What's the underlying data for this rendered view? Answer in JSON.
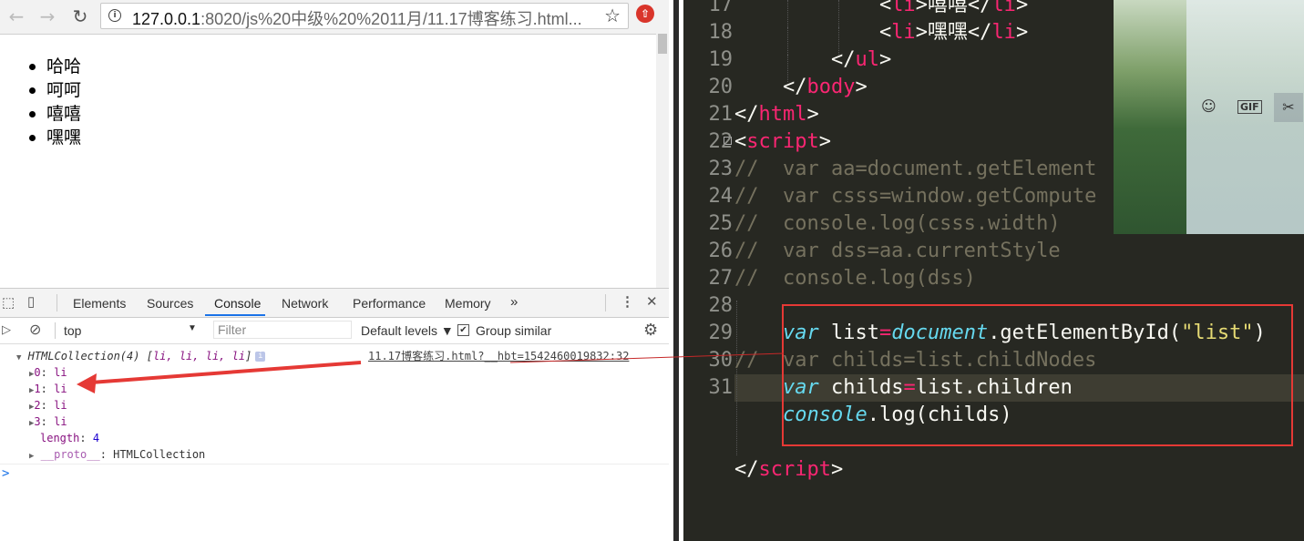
{
  "browser": {
    "url_host": "127.0.0.1",
    "url_rest": ":8020/js%20中级%20%2011月/11.17博客练习.html...",
    "nav": {
      "back": "←",
      "forward": "→",
      "reload": "↻"
    },
    "star": "☆",
    "ext_badge": "●"
  },
  "page": {
    "list_items": [
      "哈哈",
      "呵呵",
      "嘻嘻",
      "嘿嘿"
    ]
  },
  "devtools": {
    "tabs": [
      "Elements",
      "Sources",
      "Console",
      "Network",
      "Performance",
      "Memory"
    ],
    "more": "»",
    "console_bar": {
      "context": "top",
      "filter_placeholder": "Filter",
      "levels": "Default levels ▼",
      "group_label": "Group similar",
      "group_checked": "✔"
    },
    "log": {
      "head_prefix": "HTMLCollection(4) [",
      "head_items": "li, li, li, li",
      "head_suffix": "]",
      "source": "11.17博客练习.html?__hbt=1542460019832:32",
      "entries": [
        {
          "index": "0",
          "value": "li"
        },
        {
          "index": "1",
          "value": "li"
        },
        {
          "index": "2",
          "value": "li"
        },
        {
          "index": "3",
          "value": "li"
        }
      ],
      "length_key": "length",
      "length_value": "4",
      "proto_key": "__proto__",
      "proto_value": "HTMLCollection"
    },
    "prompt": ">"
  },
  "editor": {
    "lines": [
      {
        "n": "17",
        "code": [
          [
            "p",
            "            <"
          ],
          [
            "t",
            "li"
          ],
          [
            "p",
            ">嘻嘻</"
          ],
          [
            "t",
            "li"
          ],
          [
            "p",
            ">"
          ]
        ]
      },
      {
        "n": "18",
        "code": [
          [
            "p",
            "            <"
          ],
          [
            "t",
            "li"
          ],
          [
            "p",
            ">嘿嘿</"
          ],
          [
            "t",
            "li"
          ],
          [
            "p",
            ">"
          ]
        ]
      },
      {
        "n": "19",
        "code": [
          [
            "p",
            "        </"
          ],
          [
            "t",
            "ul"
          ],
          [
            "p",
            ">"
          ]
        ]
      },
      {
        "n": "20",
        "code": [
          [
            "p",
            "    </"
          ],
          [
            "t",
            "body"
          ],
          [
            "p",
            ">"
          ]
        ]
      },
      {
        "n": "21",
        "code": [
          [
            "p",
            "</"
          ],
          [
            "t",
            "html"
          ],
          [
            "p",
            ">"
          ]
        ]
      },
      {
        "n": "22",
        "code": [
          [
            "p",
            "<"
          ],
          [
            "t",
            "script"
          ],
          [
            "p",
            ">"
          ]
        ]
      },
      {
        "n": "23",
        "code": [
          [
            "c",
            "//  var aa=document.getElement"
          ]
        ]
      },
      {
        "n": "24",
        "code": [
          [
            "c",
            "//  var csss=window.getCompute"
          ]
        ]
      },
      {
        "n": "25",
        "code": [
          [
            "c",
            "//  console.log(csss.width)"
          ]
        ]
      },
      {
        "n": "26",
        "code": [
          [
            "c",
            "//  var dss=aa.currentStyle"
          ]
        ]
      },
      {
        "n": "27",
        "code": [
          [
            "c",
            "//  console.log(dss)"
          ]
        ]
      },
      {
        "n": "28",
        "code": []
      },
      {
        "n": "29",
        "code": [
          [
            "p",
            "    "
          ],
          [
            "v",
            "var"
          ],
          [
            "p",
            " list"
          ],
          [
            "t",
            "="
          ],
          [
            "v",
            "document"
          ],
          [
            "p",
            ".getElementById("
          ],
          [
            "s",
            "\"list\""
          ],
          [
            "p",
            ")"
          ]
        ]
      },
      {
        "n": "30",
        "code": [
          [
            "c",
            "//  var childs=list.childNodes"
          ]
        ]
      },
      {
        "n": "31",
        "code": [
          [
            "p",
            "    "
          ],
          [
            "v",
            "var"
          ],
          [
            "p",
            " childs"
          ],
          [
            "t",
            "="
          ],
          [
            "p",
            "list.children"
          ]
        ]
      },
      {
        "n": "",
        "code": [
          [
            "p",
            "    "
          ],
          [
            "v",
            "console"
          ],
          [
            "p",
            ".log(childs)"
          ]
        ]
      },
      {
        "n": "",
        "code": []
      },
      {
        "n": "",
        "code": [
          [
            "p",
            "</"
          ],
          [
            "t",
            "script"
          ],
          [
            "p",
            ">"
          ]
        ]
      }
    ]
  },
  "photo_tools": {
    "emoji": "☺",
    "gif": "GIF",
    "scissors": "✂"
  },
  "colors": {
    "editor_bg": "#272822",
    "highlight": "#e53935",
    "keyword": "#f92672",
    "var": "#66d9ef",
    "string": "#e6db74",
    "comment": "#75715e"
  }
}
